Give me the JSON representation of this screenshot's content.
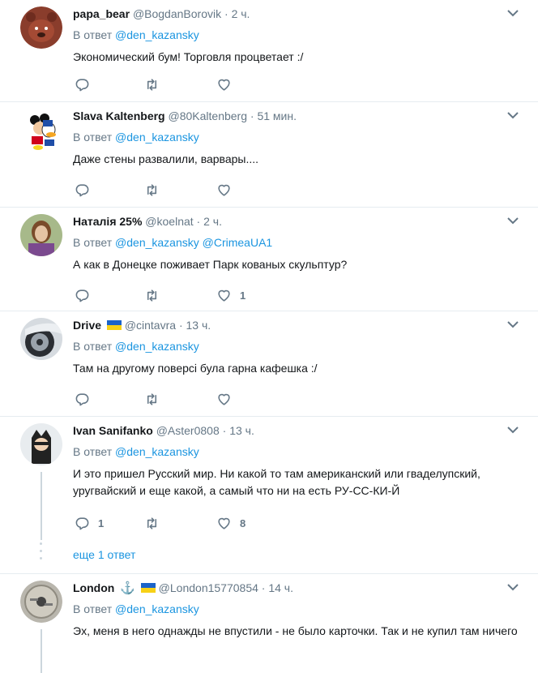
{
  "reply_label": "В ответ",
  "more_replies": "еще 1 ответ",
  "replies": [
    {
      "name": "papa_bear",
      "handle": "@BogdanBorovik",
      "time": "2 ч.",
      "mentions": [
        "@den_kazansky"
      ],
      "text": "Экономический бум! Торговля процветает :/",
      "reply_count": "",
      "like_count": ""
    },
    {
      "name": "Slava Kaltenberg",
      "handle": "@80Kaltenberg",
      "time": "51 мин.",
      "mentions": [
        "@den_kazansky"
      ],
      "text": "Даже стены развалили, варвары....",
      "reply_count": "",
      "like_count": ""
    },
    {
      "name": "Наталія 25%",
      "handle": "@koelnat",
      "time": "2 ч.",
      "mentions": [
        "@den_kazansky",
        "@CrimeaUA1"
      ],
      "text": "А как в Донецке поживает Парк кованых скульптур?",
      "reply_count": "",
      "like_count": "1"
    },
    {
      "name": "Drive",
      "handle": "@cintavra",
      "time": "13 ч.",
      "mentions": [
        "@den_kazansky"
      ],
      "text": "Там на другому поверсі була гарна кафешка :/",
      "reply_count": "",
      "like_count": ""
    },
    {
      "name": "Ivan Sanifanko",
      "handle": "@Aster0808",
      "time": "13 ч.",
      "mentions": [
        "@den_kazansky"
      ],
      "text": "И это пришел Русский мир. Ни какой то там американский или гваделупский, уругвайский и еще какой, а самый что ни на есть РУ-СС-КИ-Й",
      "reply_count": "1",
      "like_count": "8"
    },
    {
      "name": "London",
      "handle": "@London15770854",
      "time": "14 ч.",
      "mentions": [
        "@den_kazansky"
      ],
      "text": "Эх, меня в него однажды не впустили - не было карточки. Так и не купил там ничего",
      "reply_count": "",
      "like_count": ""
    }
  ]
}
